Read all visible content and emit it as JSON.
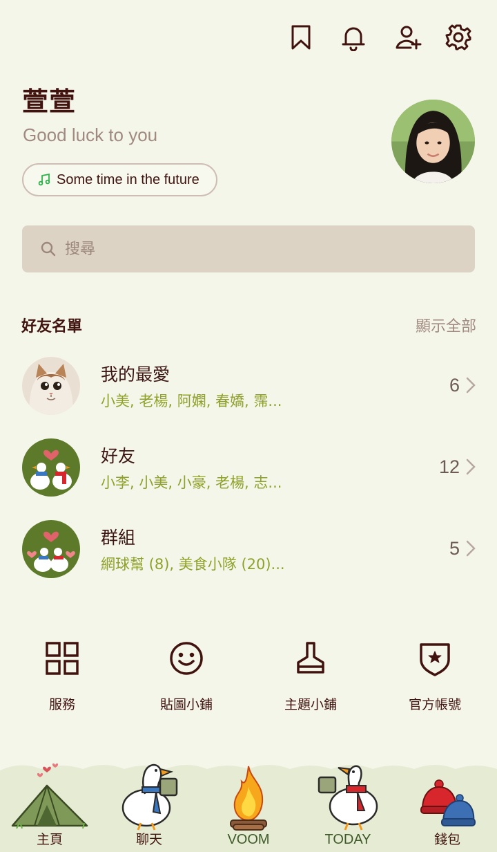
{
  "header": {
    "icons": [
      "bookmark-icon",
      "bell-icon",
      "add-friend-icon",
      "gear-icon"
    ]
  },
  "profile": {
    "name": "萱萱",
    "status": "Good luck to you",
    "music": "Some time in the future"
  },
  "search": {
    "placeholder": "搜尋"
  },
  "friends_section": {
    "title": "好友名單",
    "show_all": "顯示全部",
    "rows": [
      {
        "title": "我的最愛",
        "subtitle": "小美, 老楊, 阿嫻, 春嬌, 霈...",
        "count": "6"
      },
      {
        "title": "好友",
        "subtitle": "小李, 小美, 小豪, 老楊, 志...",
        "count": "12"
      },
      {
        "title": "群組",
        "subtitle": "網球幫 (8), 美食小隊 (20)...",
        "count": "5"
      }
    ]
  },
  "services": [
    {
      "label": "服務",
      "icon": "grid-icon"
    },
    {
      "label": "貼圖小鋪",
      "icon": "smile-icon"
    },
    {
      "label": "主題小鋪",
      "icon": "brush-icon"
    },
    {
      "label": "官方帳號",
      "icon": "shield-star-icon"
    }
  ],
  "bottom_nav": [
    {
      "label": "主頁",
      "icon": "tent-icon"
    },
    {
      "label": "聊天",
      "icon": "goose-icon"
    },
    {
      "label": "VOOM",
      "icon": "campfire-icon"
    },
    {
      "label": "TODAY",
      "icon": "goose-cup-icon"
    },
    {
      "label": "錢包",
      "icon": "hats-icon"
    }
  ],
  "colors": {
    "background": "#f5f6ea",
    "text_primary": "#40130e",
    "text_muted": "#a08a80",
    "subtitle_green": "#8fa12b",
    "search_bg": "#ddd3c5"
  }
}
